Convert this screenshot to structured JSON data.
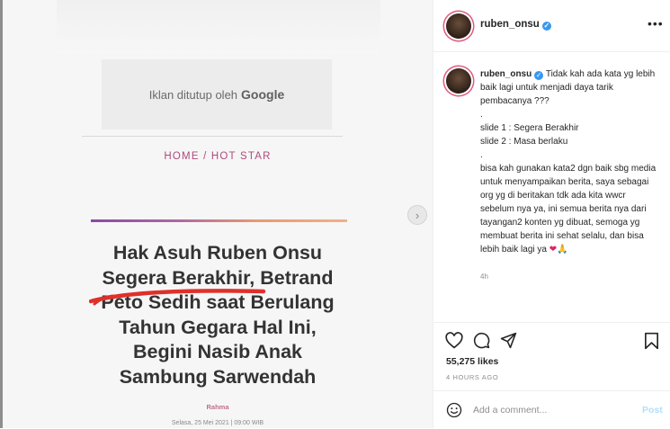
{
  "media": {
    "ad_text": "Iklan ditutup oleh",
    "ad_brand": "Google",
    "breadcrumb": "HOME /  HOT STAR",
    "headline_lines": [
      "Hak Asuh Ruben Onsu",
      "Segera Berakhir, Betrand",
      "Peto Sedih saat Berulang",
      "Tahun Gegara Hal Ini,",
      "Begini Nasib Anak",
      "Sambung Sarwendah"
    ],
    "author": "Rahma",
    "date": "Selasa, 25 Mei 2021 | 09:00 WIB",
    "next_glyph": "›"
  },
  "header": {
    "username": "ruben_onsu",
    "verified_glyph": "✓",
    "more_glyph": "•••"
  },
  "caption": {
    "username": "ruben_onsu",
    "lines": [
      "Tidak kah ada kata yg lebih baik lagi untuk menjadi daya tarik pembacanya ???",
      ".",
      "slide 1 : Segera Berakhir",
      "slide 2 : Masa berlaku",
      ".",
      "bisa kah gunakan kata2 dgn baik sbg media untuk menyampaikan berita, saya sebagai org yg di beritakan tdk ada kita wwcr sebelum nya ya, ini semua berita nya dari tayangan2 konten yg dibuat, semoga yg membuat berita ini sehat selalu, dan bisa lebih baik lagi ya"
    ],
    "emoji_heart": "❤",
    "emoji_pray": "🙏",
    "time": "4h"
  },
  "actions": {
    "icons": [
      "heart-icon",
      "comment-icon",
      "share-icon",
      "bookmark-icon"
    ],
    "likes": "55,275 likes",
    "posted_ago": "4 HOURS AGO"
  },
  "comment": {
    "placeholder": "Add a comment...",
    "post_label": "Post"
  },
  "colors": {
    "breadcrumb": "#b04a7c",
    "accent_start": "#8a4aa5",
    "accent_end": "#f2b088",
    "verified": "#3897f0",
    "post_disabled": "#b2dffc",
    "heart": "#e0245e"
  }
}
